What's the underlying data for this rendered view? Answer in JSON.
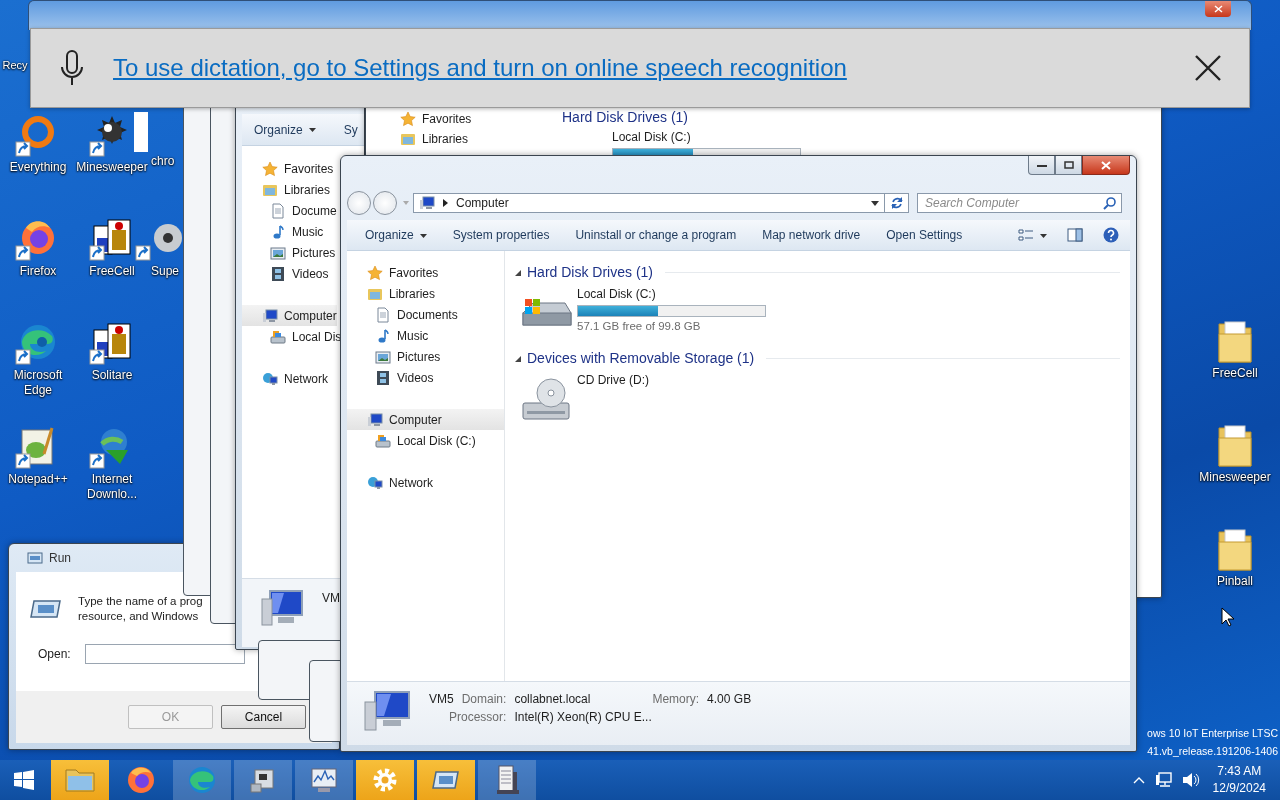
{
  "desktop_icons": [
    {
      "label": "Recy",
      "kind": "none"
    },
    {
      "label": "Everything",
      "kind": "ring",
      "shortcut": true
    },
    {
      "label": "Minesweeper",
      "kind": "mine",
      "shortcut": true
    },
    {
      "label": "chro",
      "kind": "blank"
    },
    {
      "label": "Firefox",
      "kind": "firefox",
      "shortcut": true
    },
    {
      "label": "FreeCell",
      "kind": "cards",
      "shortcut": true
    },
    {
      "label": "Supe",
      "kind": "disc",
      "shortcut": true
    },
    {
      "label": "Microsoft Edge",
      "kind": "edge",
      "shortcut": true
    },
    {
      "label": "Solitare",
      "kind": "cards",
      "shortcut": true
    },
    {
      "label": "Notepad++",
      "kind": "notepad",
      "shortcut": true
    },
    {
      "label": "Internet Downlo...",
      "kind": "download",
      "shortcut": true
    },
    {
      "label": "FreeCell",
      "kind": "folder",
      "shortcut": false
    },
    {
      "label": "Minesweeper",
      "kind": "folder",
      "shortcut": false
    },
    {
      "label": "Pinball",
      "kind": "folder",
      "shortcut": false
    }
  ],
  "run_dialog": {
    "title": "Run",
    "description": "Type the name of a prog resource, and Windows",
    "open_label": "Open:",
    "buttons": [
      {
        "label": "OK",
        "disabled": true
      },
      {
        "label": "Cancel",
        "disabled": false
      }
    ]
  },
  "background_window_1": {
    "toolbar": [
      {
        "label": "Organize",
        "dropdown": true
      },
      {
        "label": "Sy",
        "dropdown": false
      }
    ],
    "nav": [
      {
        "items": [
          {
            "label": "Favorites",
            "kind": "star",
            "selected": false
          },
          {
            "label": "Libraries",
            "kind": "library",
            "selected": false,
            "children": [
              {
                "label": "Docume",
                "kind": "doc",
                "selected": false
              },
              {
                "label": "Music",
                "kind": "music",
                "selected": false
              },
              {
                "label": "Pictures",
                "kind": "picture",
                "selected": false
              },
              {
                "label": "Videos",
                "kind": "video",
                "selected": false
              }
            ]
          }
        ]
      },
      {
        "items": [
          {
            "label": "Computer",
            "kind": "computer",
            "selected": true,
            "children": [
              {
                "label": "Local Dis",
                "kind": "drive",
                "selected": false
              }
            ]
          }
        ]
      },
      {
        "items": [
          {
            "label": "Network",
            "kind": "network",
            "selected": false
          }
        ]
      }
    ],
    "details": {
      "name": "VM"
    }
  },
  "background_window_2": {
    "nav": [
      {
        "items": [
          {
            "label": "Favorites",
            "kind": "star",
            "selected": false
          },
          {
            "label": "Libraries",
            "kind": "library",
            "selected": false
          }
        ]
      }
    ],
    "group_title": "Hard Disk Drives (1)",
    "drive": {
      "name": "Local Disk (C:)",
      "level": 0.43
    }
  },
  "explorer": {
    "address": "Computer",
    "search": {
      "placeholder": "Search Computer"
    },
    "toolbar": [
      {
        "label": "Organize",
        "dropdown": true
      },
      {
        "label": "System properties",
        "dropdown": false
      },
      {
        "label": "Uninstall or change a program",
        "dropdown": false
      },
      {
        "label": "Map network drive",
        "dropdown": false
      },
      {
        "label": "Open Settings",
        "dropdown": false
      }
    ],
    "nav": [
      {
        "items": [
          {
            "label": "Favorites",
            "kind": "star",
            "selected": false
          },
          {
            "label": "Libraries",
            "kind": "library",
            "selected": false,
            "children": [
              {
                "label": "Documents",
                "kind": "doc",
                "selected": false
              },
              {
                "label": "Music",
                "kind": "music",
                "selected": false
              },
              {
                "label": "Pictures",
                "kind": "picture",
                "selected": false
              },
              {
                "label": "Videos",
                "kind": "video",
                "selected": false
              }
            ]
          }
        ]
      },
      {
        "items": [
          {
            "label": "Computer",
            "kind": "computer",
            "selected": true,
            "children": [
              {
                "label": "Local Disk (C:)",
                "kind": "drive",
                "selected": false
              }
            ]
          }
        ]
      },
      {
        "items": [
          {
            "label": "Network",
            "kind": "network",
            "selected": false
          }
        ]
      }
    ],
    "groups": [
      {
        "title": "Hard Disk Drives (1)",
        "items": [
          {
            "name": "Local Disk (C:)",
            "kind": "hdd",
            "level": 0.43,
            "info": "57.1 GB free of 99.8 GB"
          }
        ]
      },
      {
        "title": "Devices with Removable Storage (1)",
        "items": [
          {
            "name": "CD Drive (D:)",
            "kind": "cd"
          }
        ]
      }
    ],
    "details": {
      "name": "VM5",
      "fields": [
        {
          "label": "Domain:",
          "value": "collabnet.local"
        },
        {
          "label": "Memory:",
          "value": "4.00 GB"
        },
        {
          "label": "Processor:",
          "value": "Intel(R) Xeon(R) CPU E..."
        }
      ]
    }
  },
  "dictation_banner": {
    "message": "To use dictation, go to Settings and turn on online speech recognition"
  },
  "desktop_text": [
    "ows 10 IoT Enterprise LTSC",
    "41.vb_release.191206-1406"
  ],
  "taskbar": {
    "buttons": [
      {
        "kind": "explorer",
        "active": true
      },
      {
        "kind": "firefox",
        "active": false,
        "running": false
      },
      {
        "kind": "edge",
        "active": false,
        "running": true
      },
      {
        "kind": "device",
        "active": false,
        "running": true
      },
      {
        "kind": "monitor",
        "active": false,
        "running": true
      },
      {
        "kind": "gear",
        "active": true
      },
      {
        "kind": "run",
        "active": true
      },
      {
        "kind": "server",
        "active": false,
        "running": true
      }
    ],
    "clock": {
      "time": "7:43 AM",
      "date": "12/9/2024"
    }
  }
}
